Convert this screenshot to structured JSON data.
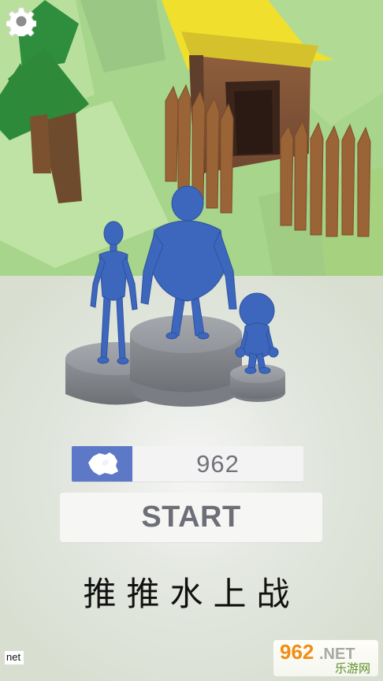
{
  "app": {
    "title": "推推水上战"
  },
  "icons": {
    "settings": "gear-icon",
    "flag": "antarctica-flag-icon"
  },
  "hud": {
    "score_value": "962",
    "flag_label": "Antarctica flag"
  },
  "actions": {
    "start_label": "START"
  },
  "footer": {
    "net_text": "net",
    "watermark_text_top": "962.NET",
    "watermark_text_bottom": "乐游网"
  },
  "colors": {
    "flag_background": "#5d78c6",
    "score_background": "#f2f3f2",
    "start_background": "#f6f7f4",
    "button_text": "#6d6e77",
    "score_text": "#72737a"
  }
}
